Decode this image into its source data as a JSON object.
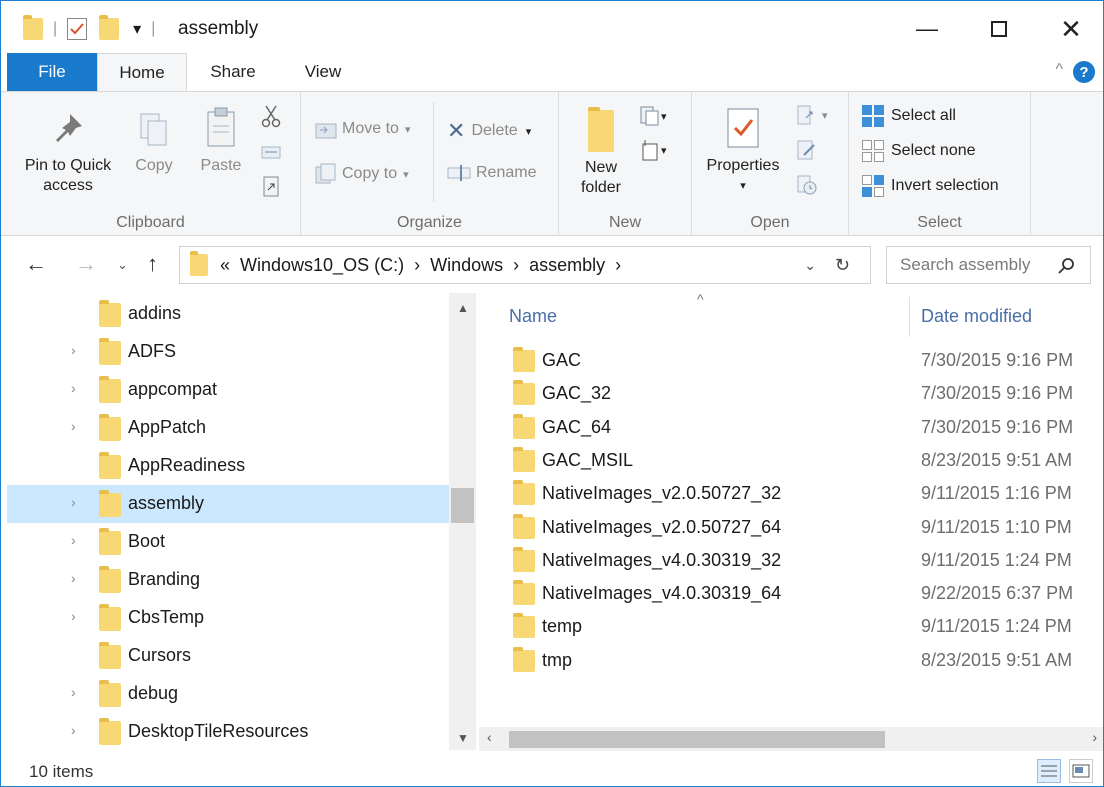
{
  "window": {
    "title": "assembly"
  },
  "tabs": {
    "file": "File",
    "home": "Home",
    "share": "Share",
    "view": "View"
  },
  "ribbon": {
    "clipboard": {
      "label": "Clipboard",
      "pin": "Pin to Quick access",
      "copy": "Copy",
      "paste": "Paste"
    },
    "organize": {
      "label": "Organize",
      "move_to": "Move to",
      "copy_to": "Copy to",
      "delete": "Delete",
      "rename": "Rename"
    },
    "new": {
      "label": "New",
      "new_folder": "New folder"
    },
    "open": {
      "label": "Open",
      "properties": "Properties"
    },
    "select": {
      "label": "Select",
      "select_all": "Select all",
      "select_none": "Select none",
      "invert": "Invert selection"
    }
  },
  "address": {
    "prefix": "«",
    "crumbs": [
      "Windows10_OS (C:)",
      "Windows",
      "assembly"
    ],
    "search_placeholder": "Search assembly"
  },
  "nav_tree": [
    {
      "label": "addins",
      "expandable": false
    },
    {
      "label": "ADFS",
      "expandable": true
    },
    {
      "label": "appcompat",
      "expandable": true
    },
    {
      "label": "AppPatch",
      "expandable": true
    },
    {
      "label": "AppReadiness",
      "expandable": false
    },
    {
      "label": "assembly",
      "expandable": true,
      "selected": true
    },
    {
      "label": "Boot",
      "expandable": true
    },
    {
      "label": "Branding",
      "expandable": true
    },
    {
      "label": "CbsTemp",
      "expandable": true
    },
    {
      "label": "Cursors",
      "expandable": false
    },
    {
      "label": "debug",
      "expandable": true
    },
    {
      "label": "DesktopTileResources",
      "expandable": true
    }
  ],
  "columns": {
    "name": "Name",
    "date_modified": "Date modified"
  },
  "files": [
    {
      "name": "GAC",
      "date": "7/30/2015 9:16 PM"
    },
    {
      "name": "GAC_32",
      "date": "7/30/2015 9:16 PM"
    },
    {
      "name": "GAC_64",
      "date": "7/30/2015 9:16 PM"
    },
    {
      "name": "GAC_MSIL",
      "date": "8/23/2015 9:51 AM"
    },
    {
      "name": "NativeImages_v2.0.50727_32",
      "date": "9/11/2015 1:16 PM"
    },
    {
      "name": "NativeImages_v2.0.50727_64",
      "date": "9/11/2015 1:10 PM"
    },
    {
      "name": "NativeImages_v4.0.30319_32",
      "date": "9/11/2015 1:24 PM"
    },
    {
      "name": "NativeImages_v4.0.30319_64",
      "date": "9/22/2015 6:37 PM"
    },
    {
      "name": "temp",
      "date": "9/11/2015 1:24 PM"
    },
    {
      "name": "tmp",
      "date": "8/23/2015 9:51 AM"
    }
  ],
  "status": {
    "item_count": "10 items"
  },
  "colors": {
    "accent": "#1979ca",
    "folder": "#f8d775",
    "selection": "#cce8ff"
  }
}
